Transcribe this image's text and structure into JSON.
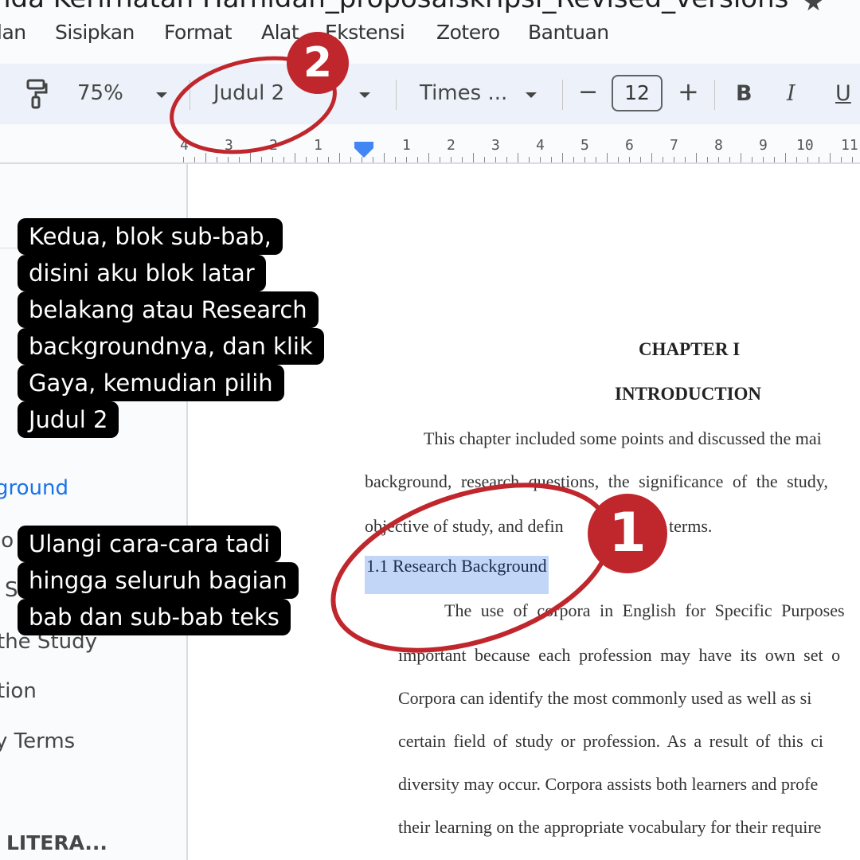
{
  "titlebar": {
    "doc_title": "nda Kerirhatan Harnidan_proposalskripsi_Revised_versions",
    "star_icon": "★"
  },
  "menu": {
    "items": [
      "lan",
      "Sisipkan",
      "Format",
      "Alat",
      "Ekstensi",
      "Zotero",
      "Bantuan"
    ]
  },
  "toolbar": {
    "paint_format_icon": "paint-roller",
    "zoom": "75%",
    "style": "Judul 2",
    "font": "Times ...",
    "decrease_font": "−",
    "font_size": "12",
    "increase_font": "+",
    "bold": "B",
    "italic": "I",
    "underline": "U"
  },
  "ruler": {
    "left_labels": [
      "4",
      "3",
      "2",
      "1"
    ],
    "right_labels": [
      "1",
      "2",
      "3",
      "4",
      "5",
      "6",
      "7",
      "8",
      "9",
      "10",
      "11"
    ]
  },
  "sidebar": {
    "items": [
      {
        "label": "ground",
        "active": true
      },
      {
        "label": "io",
        "active": false
      },
      {
        "label": "S",
        "active": false
      },
      {
        "label": "the Study",
        "active": false
      },
      {
        "label": "tion",
        "active": false
      },
      {
        "label": "y Terms",
        "active": false
      },
      {
        "label": "LITERA...",
        "active": false
      }
    ]
  },
  "document": {
    "chapter": "CHAPTER I",
    "title": "INTRODUCTION",
    "intro_lines": [
      "This chapter included some points and discussed the mai",
      "background, research questions, the significance of the study,",
      "objective of study, and defin",
      "terms."
    ],
    "subheading": "1.1 Research Background",
    "body_lines": [
      "The use of corpora in English for Specific Purposes",
      "important because each profession may have its own set o",
      "Corpora can identify the most commonly used as well as si",
      "certain field of study or profession. As a result of this ci",
      "diversity may occur. Corpora assists both learners and profe",
      "their learning on the appropriate vocabulary for their require"
    ]
  },
  "annotations": {
    "callout_1_lines": [
      "Kedua, blok sub-bab,",
      "disini aku blok latar",
      "belakang atau Research",
      "backgroundnya, dan klik",
      "Gaya, kemudian pilih",
      "Judul 2"
    ],
    "callout_2_lines": [
      "Ulangi cara-cara tadi",
      "hingga seluruh bagian",
      "bab dan sub-bab teks"
    ],
    "badge_1": "1",
    "badge_2": "2",
    "accent_color": "#c0272d"
  }
}
